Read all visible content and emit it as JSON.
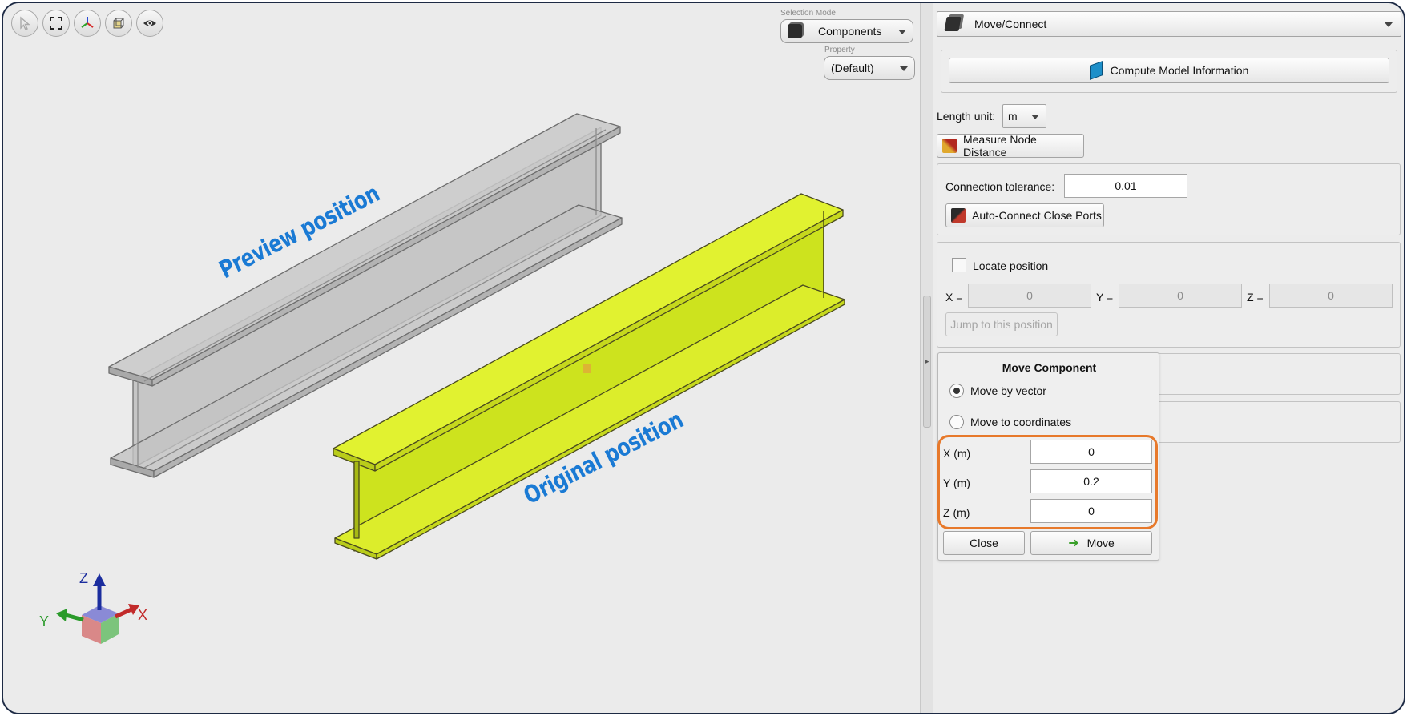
{
  "toolbar": {
    "icons": [
      "pointer-icon",
      "fit-view-icon",
      "axes-icon",
      "view-cube-icon",
      "eye-icon"
    ]
  },
  "selection_mode": {
    "label": "Selection Mode",
    "value": "Components"
  },
  "property": {
    "label": "Property",
    "value": "(Default)"
  },
  "annotations": {
    "preview": "Preview position",
    "original": "Original position"
  },
  "triad": {
    "x": "X",
    "y": "Y",
    "z": "Z"
  },
  "panel": {
    "tool_select": "Move/Connect",
    "compute_button": "Compute Model Information",
    "length_unit_label": "Length unit:",
    "length_unit_value": "m",
    "measure_button": "Measure Node Distance",
    "connection_tolerance_label": "Connection tolerance:",
    "connection_tolerance_value": "0.01",
    "auto_connect_button": "Auto-Connect Close Ports",
    "locate_position_label": "Locate position",
    "locate_x_label": "X =",
    "locate_y_label": "Y =",
    "locate_z_label": "Z =",
    "locate_x": "0",
    "locate_y": "0",
    "locate_z": "0",
    "jump_button": "Jump to this position"
  },
  "move_component": {
    "title": "Move Component",
    "option_vector": "Move by vector",
    "option_coordinates": "Move to coordinates",
    "selected_option": "Move by vector",
    "x_label": "X (m)",
    "y_label": "Y (m)",
    "z_label": "Z (m)",
    "x_value": "0",
    "y_value": "0.2",
    "z_value": "0",
    "close_button": "Close",
    "move_button": "Move"
  },
  "colors": {
    "accent_highlight": "#e7792b",
    "annotation_text": "#1a7ad4",
    "beam_selected": "#dff02a",
    "beam_preview": "#bdbdbd"
  }
}
